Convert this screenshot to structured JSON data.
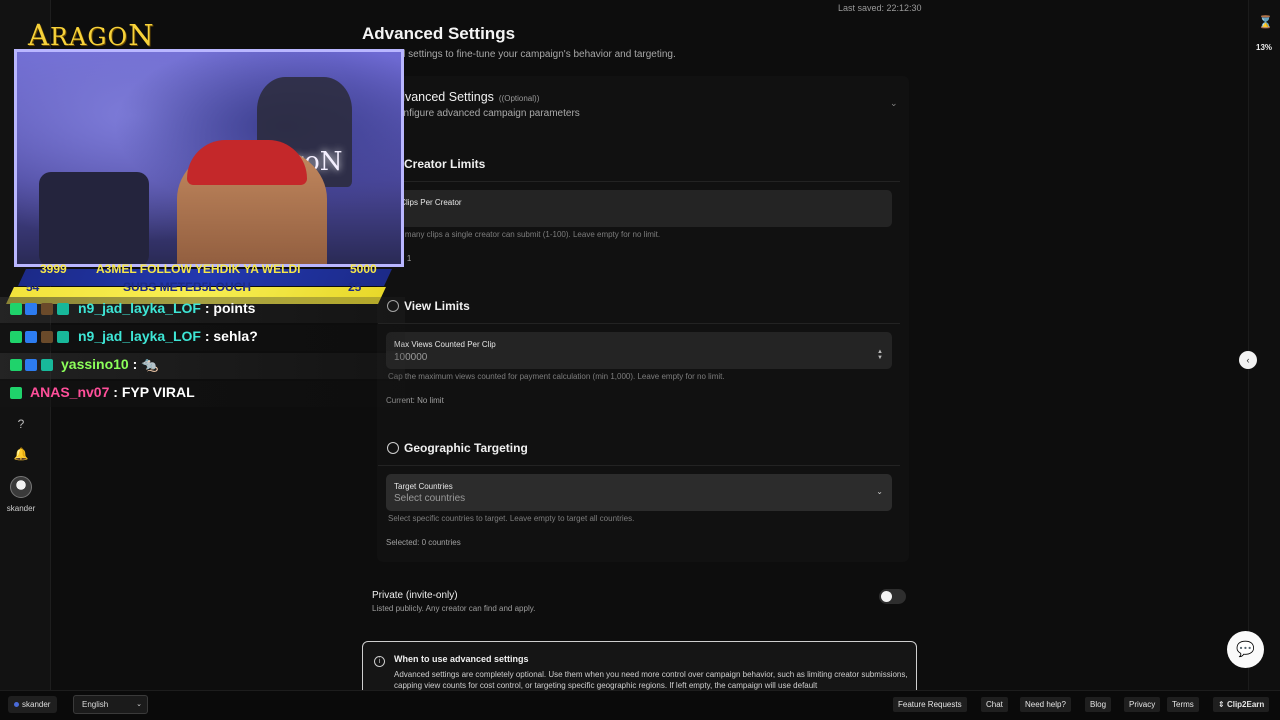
{
  "header": {
    "last_saved": "Last saved: 22:12:30"
  },
  "page": {
    "title": "Advanced Settings",
    "subtitle": "advanced settings to fine-tune your campaign's behavior and targeting."
  },
  "advanced_panel": {
    "title": "dvanced Settings",
    "optional": "((Optional))",
    "subtitle": "onfigure advanced campaign parameters"
  },
  "creator_limits": {
    "title": "Creator Limits",
    "field_label": "x Clips Per Creator",
    "field_value": "",
    "help": "how many clips a single creator can submit (1-100). Leave empty for no limit.",
    "current": "rrent: 1"
  },
  "view_limits": {
    "title": "View Limits",
    "field_label": "Max Views Counted Per Clip",
    "field_placeholder": "100000",
    "help": "Cap the maximum views counted for payment calculation (min 1,000). Leave empty for no limit.",
    "current": "Current: No limit"
  },
  "geo": {
    "title": "Geographic Targeting",
    "field_label": "Target Countries",
    "field_placeholder": "Select countries",
    "help": "Select specific countries to target. Leave empty to target all countries.",
    "selected": "Selected: 0 countries"
  },
  "private": {
    "title": "Private (invite-only)",
    "subtitle": "Listed publicly. Any creator can find and apply.",
    "enabled": false
  },
  "info": {
    "title": "When to use advanced settings",
    "text": "Advanced settings are completely optional. Use them when you need more control over campaign behavior, such as limiting creator submissions, capping view counts for cost control, or targeting specific geographic regions. If left empty, the campaign will use default"
  },
  "right_panel": {
    "progress": "13%",
    "progress_value": 13
  },
  "sidebar": {
    "user": "skander"
  },
  "bottom": {
    "user": "skander",
    "language": "English",
    "links": [
      "Feature Requests",
      "Chat",
      "Need help?",
      "Blog",
      "Privacy",
      "Terms"
    ],
    "brand": "Clip2Earn"
  },
  "stream": {
    "logo_first": "A",
    "logo_rest": "RAGO",
    "logo_last": "N",
    "sign": "agoN",
    "goal1": {
      "left": "3999",
      "text": "A3MEL FOLLOW YEHDIK YA WELDI",
      "right": "5000"
    },
    "goal2": {
      "left": "54",
      "text": "SUBS METEB5LOUCH",
      "right": "25"
    },
    "chat": [
      {
        "user": "n9_jad_layka_LOF",
        "message": " : points",
        "color": "#3ee6d6"
      },
      {
        "user": "n9_jad_layka_LOF",
        "message": " : sehla?",
        "color": "#3ee6d6"
      },
      {
        "user": "yassino10",
        "message": " : 🐀",
        "color": "#8cff5a"
      },
      {
        "user": "ANAS_nv07",
        "message": " : FYP VIRAL",
        "color": "#ff4f9a"
      }
    ]
  },
  "colors": {
    "accent": "#f7d23a",
    "background": "#0d0d0d",
    "panel": "#111111",
    "field": "#242424"
  }
}
